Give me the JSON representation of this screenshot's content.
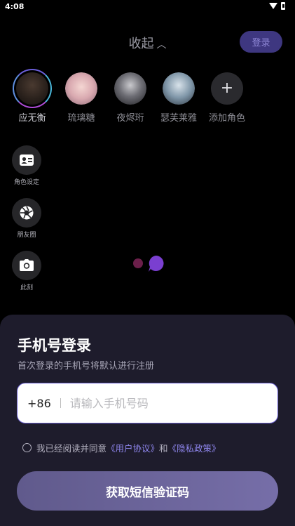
{
  "status_bar": {
    "time": "4:08"
  },
  "header": {
    "collapse_label": "收起",
    "login_button": "登录"
  },
  "characters": [
    {
      "name": "应无衡",
      "active": true
    },
    {
      "name": "琉璃糖",
      "active": false
    },
    {
      "name": "夜烬珩",
      "active": false
    },
    {
      "name": "瑟芙莱雅",
      "active": false
    },
    {
      "name": "添加角色",
      "active": false,
      "is_add": true
    }
  ],
  "side_menu": [
    {
      "label": "角色设定",
      "icon": "id-card-icon"
    },
    {
      "label": "朋友圈",
      "icon": "aperture-icon"
    },
    {
      "label": "此刻",
      "icon": "camera-icon"
    }
  ],
  "login_sheet": {
    "title": "手机号登录",
    "subtitle": "首次登录的手机号将默认进行注册",
    "country_code": "+86",
    "phone_placeholder": "请输入手机号码",
    "agreement_prefix": "我已经阅读并同意",
    "user_agreement": "《用户协议》",
    "and": "和",
    "privacy_policy": "《隐私政策》",
    "submit": "获取短信验证码"
  },
  "colors": {
    "accent": "#6a5fd0",
    "link": "#8f86ee",
    "sheet_bg": "#1e1c2c"
  }
}
